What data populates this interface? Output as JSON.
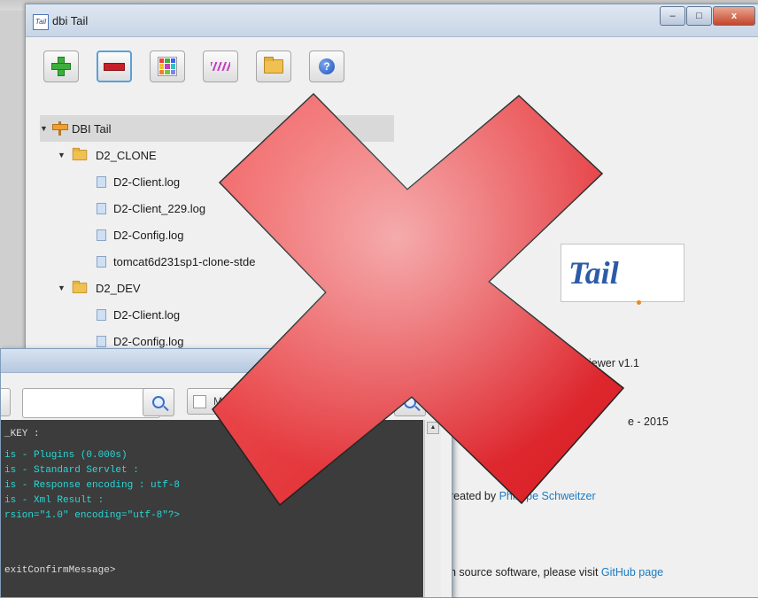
{
  "main_window": {
    "title": "dbi Tail",
    "app_icon_text": "Tail",
    "controls": {
      "minimize": "–",
      "maximize": "□",
      "close": "x"
    }
  },
  "toolbar": {
    "buttons": [
      {
        "name": "add-log-button",
        "icon": "green-plus-icon"
      },
      {
        "name": "remove-log-button",
        "icon": "red-minus-icon",
        "active": true
      },
      {
        "name": "colors-button",
        "icon": "color-grid-icon"
      },
      {
        "name": "pattern-button",
        "icon": "stripes-icon"
      },
      {
        "name": "open-folder-button",
        "icon": "folder-icon"
      },
      {
        "name": "help-button",
        "icon": "help-icon",
        "label": "?"
      }
    ]
  },
  "tree": {
    "root": "DBI Tail",
    "groups": [
      {
        "name": "D2_CLONE",
        "files": [
          "D2-Client.log",
          "D2-Client_229.log",
          "D2-Config.log",
          "tomcat6d231sp1-clone-stde"
        ]
      },
      {
        "name": "D2_DEV",
        "files": [
          "D2-Client.log",
          "D2-Config.log"
        ]
      }
    ]
  },
  "about": {
    "logo_text": "Tail",
    "version_line": "iewer v1.1",
    "copyright_line": "e - 2015",
    "copyright_prefix": "e",
    "created_by_prefix": "reated by ",
    "author": "Philippe Schweitzer",
    "open_source_prefix": "n source software, please visit ",
    "github_link": "GitHub page"
  },
  "sub_window": {
    "controls": {
      "minimize": "–",
      "maximize": "□",
      "close": "x"
    },
    "search": {
      "placeholder": "",
      "value": ""
    },
    "match_case_label": "Match Case",
    "console_lines": [
      {
        "text": "_KEY :",
        "style": "plain"
      },
      {
        "text": "is - Plugins (0.000s)",
        "style": "cyan"
      },
      {
        "text": "is - Standard Servlet :",
        "style": "cyan"
      },
      {
        "text": "is - Response encoding : utf-8",
        "style": "cyan"
      },
      {
        "text": "is - Xml Result :",
        "style": "cyan"
      },
      {
        "text": "rsion=\"1.0\" encoding=\"utf-8\"?>",
        "style": "cyan"
      },
      {
        "text": "exitConfirmMessage>",
        "style": "plain"
      }
    ]
  },
  "overlay": {
    "icon": "red-x-mark-icon",
    "color": "#e8252c"
  }
}
